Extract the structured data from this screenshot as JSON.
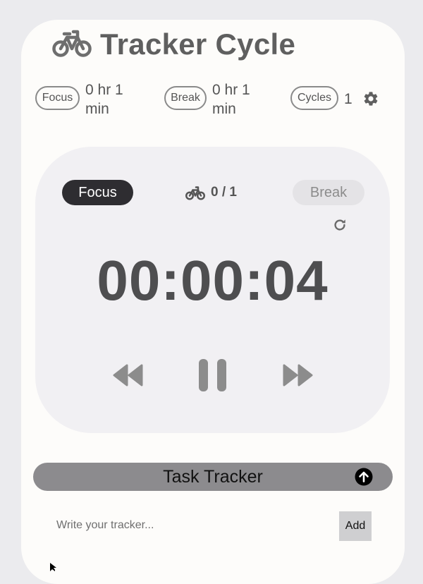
{
  "header": {
    "title": "Tracker Cycle",
    "logo_icon": "bicycle-icon"
  },
  "summary": {
    "focus_label": "Focus",
    "focus_value_line1": "0 hr 1",
    "focus_value_line2": "min",
    "break_label": "Break",
    "break_value_line1": "0 hr 1",
    "break_value_line2": "min",
    "cycles_label": "Cycles",
    "cycles_value": "1",
    "settings_icon": "gear-icon"
  },
  "timer": {
    "modes": {
      "focus": "Focus",
      "break": "Break"
    },
    "active_mode": "Focus",
    "cycle_progress": "0 / 1",
    "display": "00:00:04",
    "controls": [
      "rewind-icon",
      "pause-icon",
      "fast-forward-icon"
    ],
    "reset_icon": "reset-icon"
  },
  "tasks": {
    "title": "Task Tracker",
    "toggle_icon": "arrow-up-circle-icon",
    "input_placeholder": "Write your tracker...",
    "input_value": "",
    "add_label": "Add"
  },
  "colors": {
    "background": "#ebebee",
    "card": "#fdfcfa",
    "panel": "#f1f0f3",
    "active_mode": "#2e2d31",
    "task_bar": "#8c8b8e",
    "icon": "#8c8c8c"
  }
}
